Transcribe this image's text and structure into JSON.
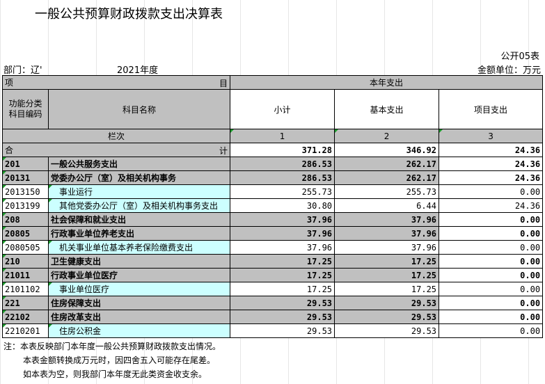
{
  "title": "一般公共预算财政拨款支出决算表",
  "form_no": "公开05表",
  "dept_label": "部门：辽'",
  "year": "2021年度",
  "unit": "金额单位：万元",
  "header": {
    "left_a": "项",
    "left_b": "目",
    "group": "本年支出",
    "col_code": "功能分类\n科目编码",
    "col_name": "科目名称",
    "col_subtotal": "小计",
    "col_basic": "基本支出",
    "col_project": "项目支出",
    "col_index": "栏次",
    "n1": "1",
    "n2": "2",
    "n3": "3"
  },
  "total": {
    "label_a": "合",
    "label_b": "计",
    "subtotal": "371.28",
    "basic": "346.92",
    "project": "24.36"
  },
  "rows": [
    {
      "code": "201",
      "name": "一般公共服务支出",
      "subtotal": "286.53",
      "basic": "262.17",
      "project": "24.36"
    },
    {
      "code": "20131",
      "name": "党委办公厅（室）及相关机构事务",
      "subtotal": "286.53",
      "basic": "262.17",
      "project": "24.36"
    },
    {
      "code": "2013150",
      "name": "事业运行",
      "subtotal": "255.73",
      "basic": "255.73",
      "project": "0.00"
    },
    {
      "code": "2013199",
      "name": "其他党委办公厅（室）及相关机构事务支出",
      "subtotal": "30.80",
      "basic": "6.44",
      "project": "24.36"
    },
    {
      "code": "208",
      "name": "社会保障和就业支出",
      "subtotal": "37.96",
      "basic": "37.96",
      "project": "0.00"
    },
    {
      "code": "20805",
      "name": "行政事业单位养老支出",
      "subtotal": "37.96",
      "basic": "37.96",
      "project": "0.00"
    },
    {
      "code": "2080505",
      "name": "机关事业单位基本养老保险缴费支出",
      "subtotal": "37.96",
      "basic": "37.96",
      "project": "0.00"
    },
    {
      "code": "210",
      "name": "卫生健康支出",
      "subtotal": "17.25",
      "basic": "17.25",
      "project": "0.00"
    },
    {
      "code": "21011",
      "name": "行政事业单位医疗",
      "subtotal": "17.25",
      "basic": "17.25",
      "project": "0.00"
    },
    {
      "code": "2101102",
      "name": "事业单位医疗",
      "subtotal": "17.25",
      "basic": "17.25",
      "project": "0.00"
    },
    {
      "code": "221",
      "name": "住房保障支出",
      "subtotal": "29.53",
      "basic": "29.53",
      "project": "0.00"
    },
    {
      "code": "22102",
      "name": "住房改革支出",
      "subtotal": "29.53",
      "basic": "29.53",
      "project": "0.00"
    },
    {
      "code": "2210201",
      "name": "住房公积金",
      "subtotal": "29.53",
      "basic": "29.53",
      "project": "0.00"
    }
  ],
  "notes": [
    "注：本表反映部门本年度一般公共预算财政拨款支出情况。",
    "本表金额转换成万元时，因四舍五入可能存在尾差。",
    "如本表为空，则我部门本年度无此类资金收支余。"
  ]
}
